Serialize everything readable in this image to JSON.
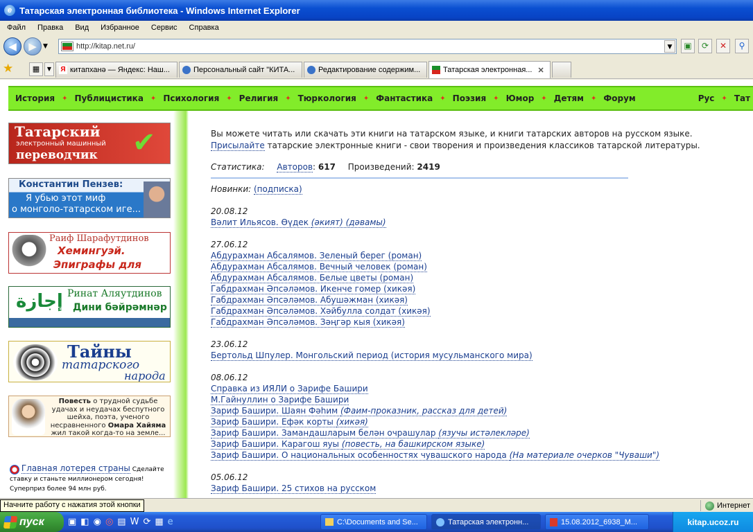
{
  "window": {
    "title": "Татарская электронная библиотека - Windows Internet Explorer"
  },
  "menu": [
    "Файл",
    "Правка",
    "Вид",
    "Избранное",
    "Сервис",
    "Справка"
  ],
  "address": {
    "url": "http://kitap.net.ru/"
  },
  "tabs": [
    "китапханә — Яндекс: Наш...",
    "Персональный сайт \"КИТА...",
    "Редактирование содержим...",
    "Татарская электронная..."
  ],
  "topnav": [
    "История",
    "Публицистика",
    "Психология",
    "Религия",
    "Тюркология",
    "Фантастика",
    "Поэзия",
    "Юмор",
    "Детям",
    "Форум"
  ],
  "lang": [
    "Рус",
    "Тат"
  ],
  "banners": {
    "translator": {
      "line1": "Татарский",
      "line2": "электронный машинный",
      "line3": "переводчик"
    },
    "penzev": {
      "line1": "Константин Пензев:",
      "line2": "Я убью этот миф",
      "line3": "о монголо-татарском иге..."
    },
    "shara": {
      "line1": "Раиф Шарафутдинов",
      "line2": "Хемингуэй.",
      "line3": "Эпиграфы для глав"
    },
    "rinat": {
      "line1": "Ринат Аляутдинов",
      "line2": "Дини бәйрәмнәр",
      "arabic": "إجازة"
    },
    "tainy": {
      "line1": "Тайны",
      "line2": "татарского",
      "line3": "народа"
    },
    "khayam": {
      "t1": "Повесть",
      "t2": " о трудной судьбе удачах и неудачах беспутного шейха, поэта, ученого несравненного ",
      "t3": "Омара Хайяма",
      "t4": " жил такой когда-то на земле..."
    },
    "lottery": {
      "link": "Главная лотерея страны",
      "text": "Сделайте ставку и станьте миллионером сегодня! Суперприз более 94 млн руб."
    }
  },
  "content": {
    "intro1": "Вы можете читать или скачать эти книги на татарском языке, и книги татарских авторов на русском языке.",
    "intro2_link": "Присылайте",
    "intro2_rest": " татарские электронные книги - свои творения и произведения классиков татарской литературы.",
    "stat_label": "Статистика:",
    "authors_label": "Авторов",
    "authors_count": "617",
    "works_label": "Произведений:",
    "works_count": "2419",
    "new_label": "Новинки:",
    "subscribe": "(подписка)",
    "groups": [
      {
        "date": "20.08.12",
        "items": [
          [
            "Вәлит Ильясов. Өүдек ",
            "(әкият) (дәвамы)"
          ]
        ]
      },
      {
        "date": "27.06.12",
        "items": [
          [
            "Абдурахман Абсалямов. Зеленый берег (роман)",
            ""
          ],
          [
            "Абдурахман Абсалямов. Вечный человек (роман)",
            ""
          ],
          [
            "Абдурахман Абсалямов. Белые цветы (роман)",
            ""
          ],
          [
            "Габдрахман Әпсәләмов. Икенче гомер (хикәя)",
            ""
          ],
          [
            "Габдрахман Әпсәләмов. Абушәжман (хикәя)",
            ""
          ],
          [
            "Габдрахман Әпсәләмов. Хәйбулла солдат (хикәя)",
            ""
          ],
          [
            "Габдрахман Әпсәләмов. Зәңгәр кыя (хикәя)",
            ""
          ]
        ]
      },
      {
        "date": "23.06.12",
        "items": [
          [
            "Бертольд Шпулер. Монгольский период (история мусульманского мира)",
            ""
          ]
        ]
      },
      {
        "date": "08.06.12",
        "items": [
          [
            "Справка из ИЯЛИ о Зарифе Башири",
            ""
          ],
          [
            "М.Гайнуллин о Зарифе Башири",
            ""
          ],
          [
            "Зариф Башири. Шаян Фәhим ",
            "(Фаим-проказник, рассказ для детей)"
          ],
          [
            "Зариф Башири. Ефәк корты ",
            "(хикәя)"
          ],
          [
            "Зариф Башири. Замандашларым белән очрашулар ",
            "(язучы истәлекләре)"
          ],
          [
            "Зариф Башири. Карагош яуы ",
            "(повесть, на башкирском языке)"
          ],
          [
            "Зариф Башири. О национальных особенностях чувашского народа ",
            "(На материале очерков \"Чуваши\")"
          ]
        ]
      },
      {
        "date": "05.06.12",
        "items": [
          [
            "Зариф Башири. 25 стихов на русском",
            ""
          ]
        ]
      }
    ]
  },
  "status": {
    "zone": "Интернет",
    "tooltip": "Начните работу с нажатия этой кнопки"
  },
  "taskbar": {
    "start": "пуск",
    "tasks": [
      "C:\\Documents and Se...",
      "Татарская электронн...",
      "15.08.2012_6938_M..."
    ],
    "tray": "kitap.ucoz.ru"
  }
}
